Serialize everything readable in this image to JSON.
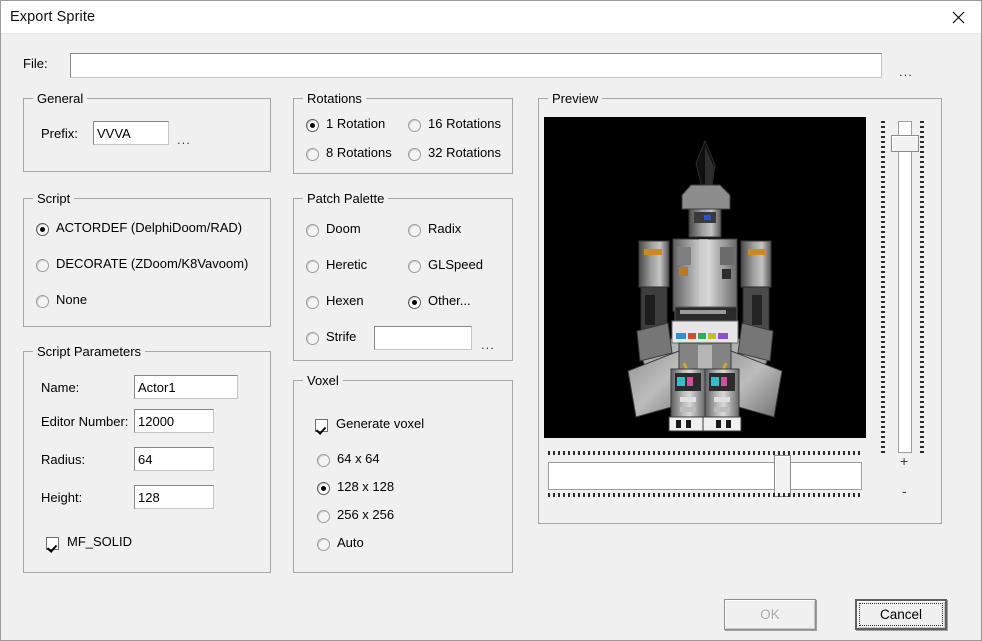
{
  "window": {
    "title": "Export Sprite",
    "close_icon": "close-icon"
  },
  "file_row": {
    "label": "File:",
    "value": "",
    "placeholder": "",
    "browse_label": "..."
  },
  "general": {
    "legend": "General",
    "prefix_label": "Prefix:",
    "prefix_value": "VVVA",
    "browse_label": "..."
  },
  "script": {
    "legend": "Script",
    "options": [
      {
        "label": "ACTORDEF (DelphiDoom/RAD)",
        "selected": true
      },
      {
        "label": "DECORATE (ZDoom/K8Vavoom)",
        "selected": false
      },
      {
        "label": "None",
        "selected": false
      }
    ]
  },
  "script_parameters": {
    "legend": "Script Parameters",
    "fields": [
      {
        "label": "Name:",
        "value": "Actor1"
      },
      {
        "label": "Editor Number:",
        "value": "12000"
      },
      {
        "label": "Radius:",
        "value": "64"
      },
      {
        "label": "Height:",
        "value": "128"
      }
    ],
    "flag": {
      "label": "MF_SOLID",
      "checked": true
    }
  },
  "rotations": {
    "legend": "Rotations",
    "options": [
      {
        "label": "1 Rotation",
        "selected": true
      },
      {
        "label": "16 Rotations",
        "selected": false
      },
      {
        "label": "8 Rotations",
        "selected": false
      },
      {
        "label": "32 Rotations",
        "selected": false
      }
    ]
  },
  "patch_palette": {
    "legend": "Patch Palette",
    "options": [
      {
        "label": "Doom",
        "selected": false
      },
      {
        "label": "Radix",
        "selected": false
      },
      {
        "label": "Heretic",
        "selected": false
      },
      {
        "label": "GLSpeed",
        "selected": false
      },
      {
        "label": "Hexen",
        "selected": false
      },
      {
        "label": "Other...",
        "selected": true
      },
      {
        "label": "Strife",
        "selected": false
      }
    ],
    "other_value": "",
    "other_browse_label": "..."
  },
  "voxel": {
    "legend": "Voxel",
    "generate": {
      "label": "Generate voxel",
      "checked": true
    },
    "sizes": [
      {
        "label": "64 x 64",
        "selected": false
      },
      {
        "label": "128 x 128",
        "selected": true
      },
      {
        "label": "256 x 256",
        "selected": false
      },
      {
        "label": "Auto",
        "selected": false
      }
    ]
  },
  "preview": {
    "legend": "Preview",
    "background_color": "#000000",
    "sprite_description": "mech robot sprite",
    "zoom_in_label": "+",
    "zoom_out_label": "-",
    "vertical_slider_value": 6,
    "horizontal_slider_value": 72
  },
  "buttons": {
    "ok": {
      "label": "OK",
      "enabled": false
    },
    "cancel": {
      "label": "Cancel",
      "focused": true
    }
  },
  "colors": {
    "dialog_background": "#f0f0f0",
    "titlebar_background": "#ffffff",
    "group_border": "#a6a6a6",
    "field_background": "#ffffff",
    "disabled_text": "#a8a8a8"
  }
}
